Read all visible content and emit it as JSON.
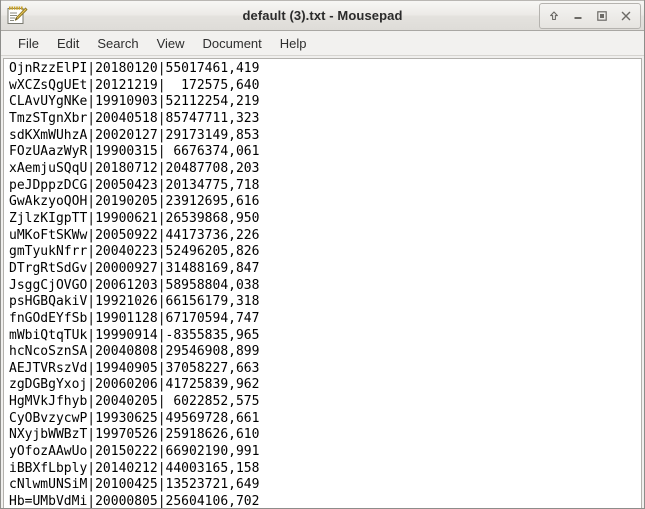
{
  "window": {
    "title": "default (3).txt - Mousepad",
    "icon": "notepad-pencil-icon",
    "controls": [
      {
        "name": "shade-button",
        "glyph": "up-arrow-icon"
      },
      {
        "name": "minimize-button",
        "glyph": "minimize-icon"
      },
      {
        "name": "maximize-button",
        "glyph": "maximize-icon"
      },
      {
        "name": "close-button",
        "glyph": "close-icon"
      }
    ]
  },
  "menubar": {
    "items": [
      {
        "label": "File"
      },
      {
        "label": "Edit"
      },
      {
        "label": "Search"
      },
      {
        "label": "View"
      },
      {
        "label": "Document"
      },
      {
        "label": "Help"
      }
    ]
  },
  "editor": {
    "lines": [
      "OjnRzzElPI|20180120|55017461,419",
      "wXCZsQgUEt|20121219|  172575,640",
      "CLAvUYgNKe|19910903|52112254,219",
      "TmzSTgnXbr|20040518|85747711,323",
      "sdKXmWUhzA|20020127|29173149,853",
      "FOzUAazWyR|19900315| 6676374,061",
      "xAemjuSQqU|20180712|20487708,203",
      "peJDppzDCG|20050423|20134775,718",
      "GwAkzyoQOH|20190205|23912695,616",
      "ZjlzKIgpTT|19900621|26539868,950",
      "uMKoFtSKWw|20050922|44173736,226",
      "gmTyukNfrr|20040223|52496205,826",
      "DTrgRtSdGv|20000927|31488169,847",
      "JsggCjOVGO|20061203|58958804,038",
      "psHGBQakiV|19921026|66156179,318",
      "fnGOdEYfSb|19901128|67170594,747",
      "mWbiQtqTUk|19990914|-8355835,965",
      "hcNcoSznSA|20040808|29546908,899",
      "AEJTVRszVd|19940905|37058227,663",
      "zgDGBgYxoj|20060206|41725839,962",
      "HgMVkJfhyb|20040205| 6022852,575",
      "CyOBvzycwP|19930625|49569728,661",
      "NXyjbWWBzT|19970526|25918626,610",
      "yOfozAAwUo|20150222|66902190,991",
      "iBBXfLbply|20140212|44003165,158",
      "cNlwmUNSiM|20100425|13523721,649",
      "Hb=UMbVdMi|20000805|25604106,702"
    ]
  }
}
